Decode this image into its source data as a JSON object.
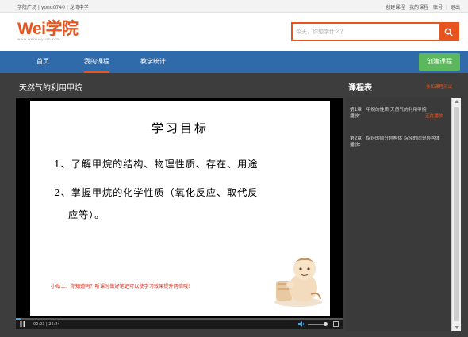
{
  "topbar": {
    "left": "学院广场 | yong0740 | 龙湾中学",
    "links": [
      "创建课程",
      "我的课程",
      "账号",
      "退出"
    ]
  },
  "logo": {
    "brand": "Wei学院",
    "url": "www.weixueyuan.com"
  },
  "search": {
    "placeholder": "今天，你想学什么？",
    "icon": "search-icon"
  },
  "nav": {
    "items": [
      "首页",
      "我的课程",
      "教学统计"
    ],
    "active": "我的课程",
    "create_label": "创建课程"
  },
  "course": {
    "title": "天然气的利用甲烷"
  },
  "slide": {
    "heading": "学习目标",
    "line1": "1、了解甲烷的结构、物理性质、存在、用途",
    "line2": "2、掌握甲烷的化学性质（氧化反应、取代反",
    "line3": "应等）。",
    "tip": "小贴士：你知道吗？听课时做好笔记可以使学习效果提升两倍哦！"
  },
  "player": {
    "time": "00:23 | 26:24",
    "progress": 0.015,
    "volume": 0.8,
    "accent": "#4aa3df"
  },
  "sidebar": {
    "title": "课程表",
    "link": "参加课程测试",
    "lessons": [
      {
        "title": "第1章：甲烷的性质 天然气的利用甲烷",
        "meta": "播放：",
        "status": "正在播放"
      },
      {
        "title": "第2章：烷烃的同分异构体 烷烃的同分异构体",
        "meta": "播放：",
        "status": ""
      }
    ]
  },
  "colors": {
    "brand": "#e8541e",
    "nav": "#2f6aab",
    "create": "#5cb85c"
  }
}
